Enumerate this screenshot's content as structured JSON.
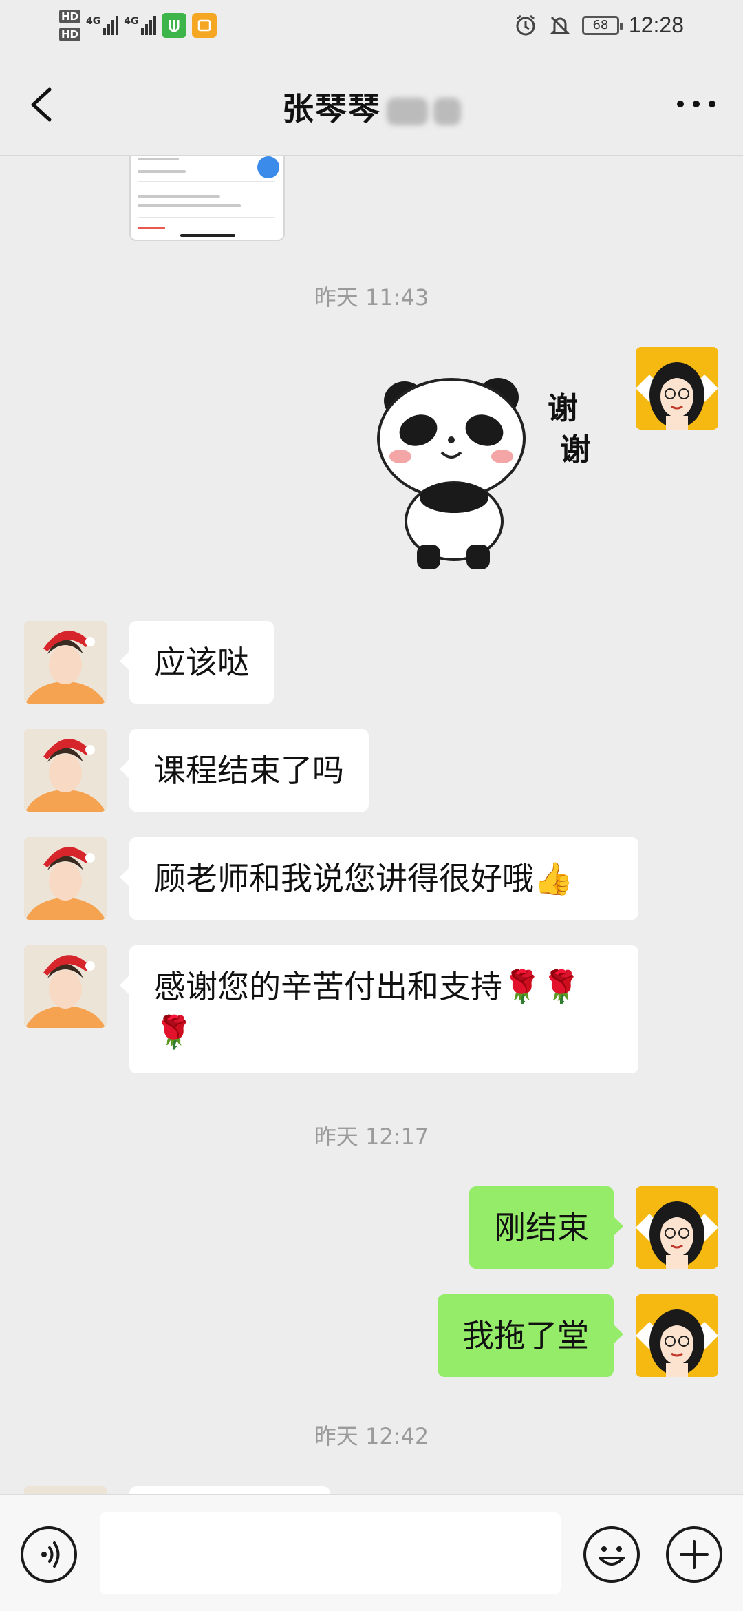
{
  "status_bar": {
    "hd1": "HD",
    "hd2": "HD",
    "net1": "4G",
    "net2": "4G",
    "battery": "68",
    "time": "12:28"
  },
  "nav": {
    "title": "张琴琴"
  },
  "messages": {
    "ts1": "昨天 11:43",
    "sticker_text_1": "谢",
    "sticker_text_2": "谢",
    "m1": "应该哒",
    "m2": "课程结束了吗",
    "m3": "顾老师和我说您讲得很好哦👍",
    "m4": "感谢您的辛苦付出和支持🌹🌹🌹",
    "ts2": "昨天 12:17",
    "m5": "刚结束",
    "m6": "我拖了堂",
    "ts3": "昨天 12:42"
  },
  "colors": {
    "background": "#ededed",
    "outgoing_bubble": "#95ec69",
    "incoming_bubble": "#ffffff",
    "timestamp": "#9b9b9b"
  },
  "icons": [
    "back-arrow-icon",
    "more-dots-icon",
    "voice-icon",
    "emoji-icon",
    "plus-icon",
    "alarm-icon",
    "mute-bell-icon"
  ]
}
